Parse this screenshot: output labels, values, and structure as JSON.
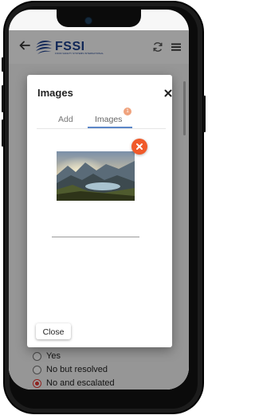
{
  "appbar": {
    "logo_text": "FSSI",
    "logo_tagline": "FOOD SAFETY SYSTEMS INTERNATIONAL"
  },
  "modal": {
    "title": "Images",
    "tabs": [
      {
        "label": "Add",
        "active": false
      },
      {
        "label": "Images",
        "active": true,
        "badge": "1"
      }
    ],
    "close_label": "Close"
  },
  "background_form": {
    "options": [
      {
        "label": "Yes",
        "checked": false
      },
      {
        "label": "No but resolved",
        "checked": false
      },
      {
        "label": "No and escalated",
        "checked": true
      }
    ]
  },
  "colors": {
    "brand": "#1c3f8d",
    "accent": "#e53935",
    "remove_button": "#f05a2a",
    "tab_underline": "#5b86c8",
    "badge": "#f0a37e"
  },
  "icons": [
    "back-arrow-icon",
    "fssi-logo-icon",
    "sync-icon",
    "menu-icon",
    "close-icon",
    "remove-image-icon"
  ]
}
